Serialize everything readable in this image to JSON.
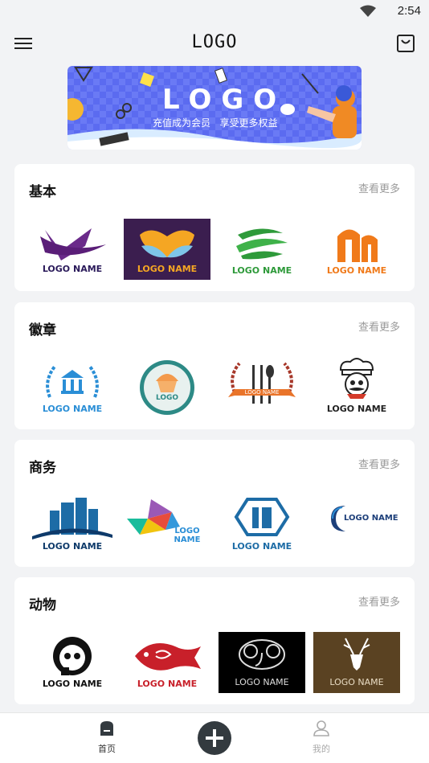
{
  "status": {
    "time": "2:54"
  },
  "app_bar": {
    "title": "LOGO"
  },
  "banner": {
    "logo_text": "LOGO",
    "tagline": "充值成为会员   享受更多权益"
  },
  "sections": [
    {
      "title": "基本",
      "more": "查看更多",
      "logos": [
        {
          "caption": "LOGO NAME",
          "icon": "purple-swoosh-logo"
        },
        {
          "caption": "LOGO NAME",
          "icon": "leaf-heart-logo"
        },
        {
          "caption": "LOGO NAME",
          "icon": "green-waves-logo"
        },
        {
          "caption": "LOGO NAME",
          "icon": "orange-arch-logo"
        }
      ]
    },
    {
      "title": "徽章",
      "more": "查看更多",
      "logos": [
        {
          "caption": "LOGO NAME",
          "icon": "laurel-bank-badge"
        },
        {
          "caption": "LOGO",
          "icon": "cupcake-badge"
        },
        {
          "caption": "LOGO NAME",
          "icon": "cutlery-laurel-badge"
        },
        {
          "caption": "LOGO NAME",
          "icon": "chef-badge"
        }
      ]
    },
    {
      "title": "商务",
      "more": "查看更多",
      "logos": [
        {
          "caption": "LOGO NAME",
          "icon": "buildings-logo"
        },
        {
          "caption": "LOGO NAME",
          "icon": "triangle-gem-logo"
        },
        {
          "caption": "LOGO NAME",
          "icon": "hexagon-building-logo"
        },
        {
          "caption": "LOGO NAME",
          "icon": "crescent-c-logo"
        }
      ]
    },
    {
      "title": "动物",
      "more": "查看更多",
      "logos": [
        {
          "caption": "LOGO NAME",
          "icon": "panda-logo"
        },
        {
          "caption": "LOGO NAME",
          "icon": "red-fish-logo"
        },
        {
          "caption": "LOGO NAME",
          "icon": "elephant-logo"
        },
        {
          "caption": "LOGO NAME",
          "icon": "deer-logo"
        }
      ]
    }
  ],
  "bottom_nav": {
    "home_label": "首页",
    "mine_label": "我的"
  },
  "colors": {
    "accent": "#333a3f",
    "muted": "#9a9a9a",
    "background": "#f2f3f5"
  }
}
